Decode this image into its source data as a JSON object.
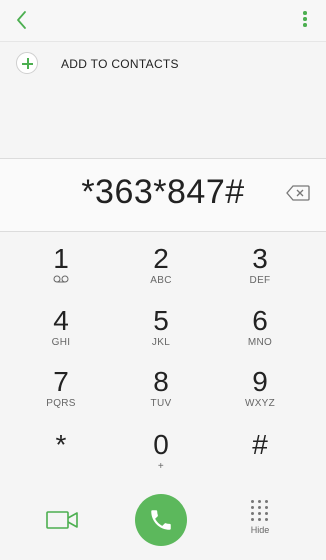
{
  "header": {
    "back_icon": "chevron-left-icon",
    "more_icon": "more-vert-icon"
  },
  "contacts": {
    "add_label": "ADD TO CONTACTS",
    "add_icon": "plus-icon"
  },
  "dialer": {
    "number": "*363*847#",
    "backspace_icon": "backspace-icon"
  },
  "keys": [
    {
      "digit": "1",
      "letters": ""
    },
    {
      "digit": "2",
      "letters": "ABC"
    },
    {
      "digit": "3",
      "letters": "DEF"
    },
    {
      "digit": "4",
      "letters": "GHI"
    },
    {
      "digit": "5",
      "letters": "JKL"
    },
    {
      "digit": "6",
      "letters": "MNO"
    },
    {
      "digit": "7",
      "letters": "PQRS"
    },
    {
      "digit": "8",
      "letters": "TUV"
    },
    {
      "digit": "9",
      "letters": "WXYZ"
    },
    {
      "digit": "*",
      "letters": ""
    },
    {
      "digit": "0",
      "letters": "+"
    },
    {
      "digit": "#",
      "letters": ""
    }
  ],
  "bottom": {
    "hide_label": "Hide",
    "video_icon": "video-call-icon",
    "call_icon": "phone-icon"
  },
  "colors": {
    "accent": "#4caf50",
    "call_button": "#5cb85c"
  }
}
